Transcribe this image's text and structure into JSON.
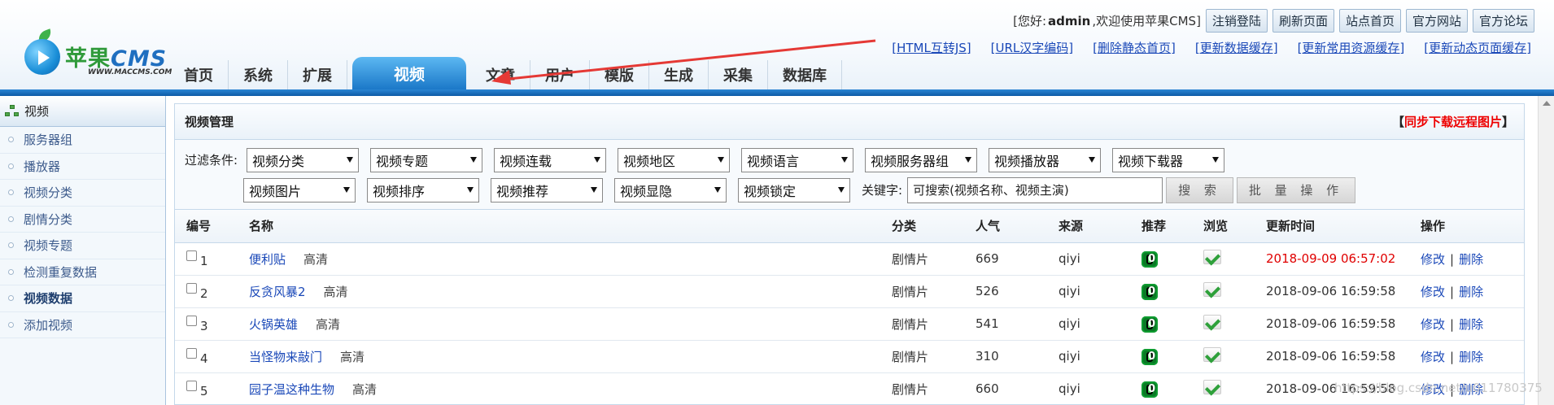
{
  "header": {
    "logo_text": "苹果",
    "logo_cms": "CMS",
    "logo_sub": "WWW.MACCMS.COM",
    "welcome_prefix": "[您好:",
    "user": "admin",
    "welcome_suffix": ",欢迎使用苹果CMS]",
    "top_buttons": [
      "注销登陆",
      "刷新页面",
      "站点首页",
      "官方网站",
      "官方论坛"
    ],
    "quick_links": [
      "[HTML互转JS]",
      "[URL汉字编码]",
      "[删除静态首页]",
      "[更新数据缓存]",
      "[更新常用资源缓存]",
      "[更新动态页面缓存]"
    ],
    "nav": [
      "首页",
      "系统",
      "扩展",
      "视频",
      "文章",
      "用户",
      "模版",
      "生成",
      "采集",
      "数据库"
    ],
    "nav_active_index": 3
  },
  "sidebar": {
    "title": "视频",
    "items": [
      "服务器组",
      "播放器",
      "视频分类",
      "剧情分类",
      "视频专题",
      "检测重复数据",
      "视频数据",
      "添加视频"
    ],
    "active_index": 6
  },
  "panel": {
    "title": "视频管理",
    "action_open": "【",
    "action_label": "同步下载远程图片",
    "action_close": "】"
  },
  "filters": {
    "label": "过滤条件:",
    "row1": [
      "视频分类",
      "视频专题",
      "视频连载",
      "视频地区",
      "视频语言",
      "视频服务器组",
      "视频播放器",
      "视频下载器"
    ],
    "row2": [
      "视频图片",
      "视频排序",
      "视频推荐",
      "视频显隐",
      "视频锁定"
    ],
    "keyword_label": "关键字:",
    "keyword_value": "可搜索(视频名称、视频主演)",
    "search_btn": "搜 索",
    "batch_btn": "批 量 操 作"
  },
  "table": {
    "headers": [
      "编号",
      "名称",
      "分类",
      "人气",
      "来源",
      "推荐",
      "浏览",
      "更新时间",
      "操作"
    ],
    "edit_label": "修改",
    "delete_label": "删除",
    "rows": [
      {
        "id": "1",
        "name": "便利贴",
        "quality": "高清",
        "category": "剧情片",
        "hits": "669",
        "source": "qiyi",
        "time": "2018-09-09 06:57:02",
        "time_color": "#e00000"
      },
      {
        "id": "2",
        "name": "反贪风暴2",
        "quality": "高清",
        "category": "剧情片",
        "hits": "526",
        "source": "qiyi",
        "time": "2018-09-06 16:59:58",
        "time_color": "#333333"
      },
      {
        "id": "3",
        "name": "火锅英雄",
        "quality": "高清",
        "category": "剧情片",
        "hits": "541",
        "source": "qiyi",
        "time": "2018-09-06 16:59:58",
        "time_color": "#333333"
      },
      {
        "id": "4",
        "name": "当怪物来敲门",
        "quality": "高清",
        "category": "剧情片",
        "hits": "310",
        "source": "qiyi",
        "time": "2018-09-06 16:59:58",
        "time_color": "#333333"
      },
      {
        "id": "5",
        "name": "园子温这种生物",
        "quality": "高清",
        "category": "剧情片",
        "hits": "660",
        "source": "qiyi",
        "time": "2018-09-06 16:59:58",
        "time_color": "#333333"
      }
    ]
  },
  "watermark": "https://blog.csdn.net/u011780375",
  "colors": {
    "nav_bar": "#1b78c8",
    "link": "#1a48b8",
    "alert_red": "#e00000",
    "icon_green": "#2ea03a"
  }
}
